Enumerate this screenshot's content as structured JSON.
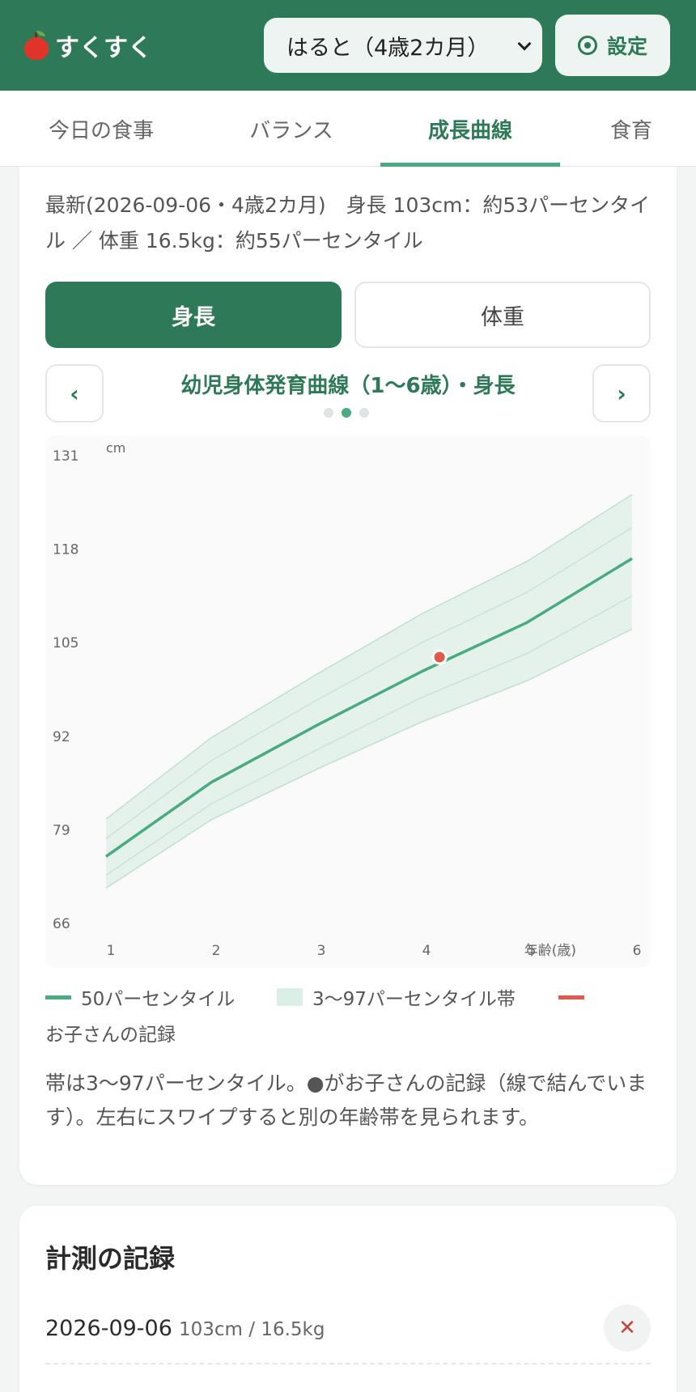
{
  "app": {
    "name": "すくすく"
  },
  "header": {
    "child_selector": {
      "value": "はると（4歳2カ月）"
    },
    "settings_label": "設定"
  },
  "tabs": [
    {
      "label": "今日の食事",
      "active": false
    },
    {
      "label": "バランス",
      "active": false
    },
    {
      "label": "成長曲線",
      "active": true
    },
    {
      "label": "食育",
      "active": false
    }
  ],
  "growth": {
    "latest_text": "最新(2026-09-06・4歳2カ月)　身長 103cm：約53パーセンタイル ／ 体重 16.5kg：約55パーセンタイル",
    "toggle": {
      "height_label": "身長",
      "weight_label": "体重",
      "selected": "身長"
    },
    "prev_label": "‹",
    "next_label": "›",
    "chart_title": "幼児身体発育曲線（1〜6歳）・身長",
    "pager": {
      "count": 3,
      "active_index": 1
    },
    "legend": {
      "median": "50パーセンタイル",
      "band": "3〜97パーセンタイル帯",
      "record": "お子さんの記録"
    },
    "note": "帯は3〜97パーセンタイル。●がお子さんの記録（線で結んでいます）。左右にスワイプすると別の年齢帯を見られます。"
  },
  "chart_data": {
    "type": "line",
    "ylabel": "cm",
    "xlabel": "年齢(歳)",
    "xlim": [
      1,
      6
    ],
    "ylim": [
      66,
      131
    ],
    "x_ticks": [
      1,
      2,
      3,
      4,
      5,
      6
    ],
    "y_ticks": [
      66,
      79,
      92,
      105,
      118,
      131
    ],
    "colors": {
      "median": "#4aaa80",
      "band": "#dcefe6",
      "record": "#e0594b"
    },
    "series": [
      {
        "name": "3〜97パーセンタイル帯",
        "x": [
          1,
          2,
          3,
          4,
          5,
          6
        ],
        "upper": [
          80.5,
          91.8,
          100.6,
          109.0,
          116.3,
          125.6
        ],
        "lower": [
          70.9,
          80.4,
          87.4,
          94.0,
          99.7,
          106.9
        ]
      },
      {
        "name": "50パーセンタイル",
        "x": [
          1,
          2,
          3,
          4,
          5,
          6
        ],
        "values": [
          75.3,
          85.6,
          93.5,
          101.0,
          107.8,
          116.7
        ]
      },
      {
        "percentiles": true,
        "x": [
          1,
          2,
          3,
          4,
          5,
          6
        ],
        "lines": [
          [
            72.7,
            82.6,
            90.1,
            97.4,
            103.5,
            111.5
          ],
          [
            77.8,
            88.6,
            97.0,
            105.0,
            112.0,
            121.0
          ]
        ]
      },
      {
        "name": "お子さんの記録",
        "x": [
          4.17
        ],
        "values": [
          103
        ]
      }
    ]
  },
  "records": {
    "title": "計測の記録",
    "items": [
      {
        "date": "2026-09-06",
        "values": "103cm / 16.5kg",
        "delete_label": "✕"
      }
    ]
  }
}
